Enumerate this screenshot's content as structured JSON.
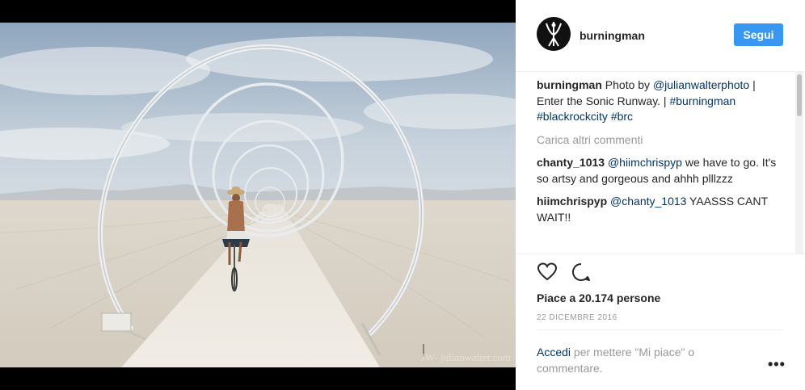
{
  "post": {
    "username": "burningman",
    "follow_label": "Segui",
    "watermark": "JW- julianwalter.com"
  },
  "caption": {
    "username": "burningman",
    "text1": " Photo by ",
    "mention": "@julianwalterphoto",
    "text2": " | Enter the Sonic Runway. | ",
    "tag1": "#burningman",
    "tag2": "#blackrockcity",
    "tag3": "#brc"
  },
  "load_more": "Carica altri commenti",
  "comments": [
    {
      "username": "chanty_1013",
      "mention": "@hiimchrispyp",
      "text": " we have to go. It's so artsy and gorgeous and ahhh plllzzz"
    },
    {
      "username": "hiimchrispyp",
      "mention": "@chanty_1013",
      "text": " YAASSS CANT WAIT!!"
    }
  ],
  "likes": "Piace a 20.174 persone",
  "date": "22 DICEMBRE 2016",
  "login": {
    "link": "Accedi",
    "text": " per mettere \"Mi piace\" o commentare."
  },
  "icons": {
    "like": "heart-icon",
    "comment": "comment-bubble-icon",
    "more": "more-options-icon",
    "avatar": "burning-man-logo"
  },
  "colors": {
    "follow_button": "#3897f0",
    "link": "#003569",
    "muted": "#999999"
  }
}
